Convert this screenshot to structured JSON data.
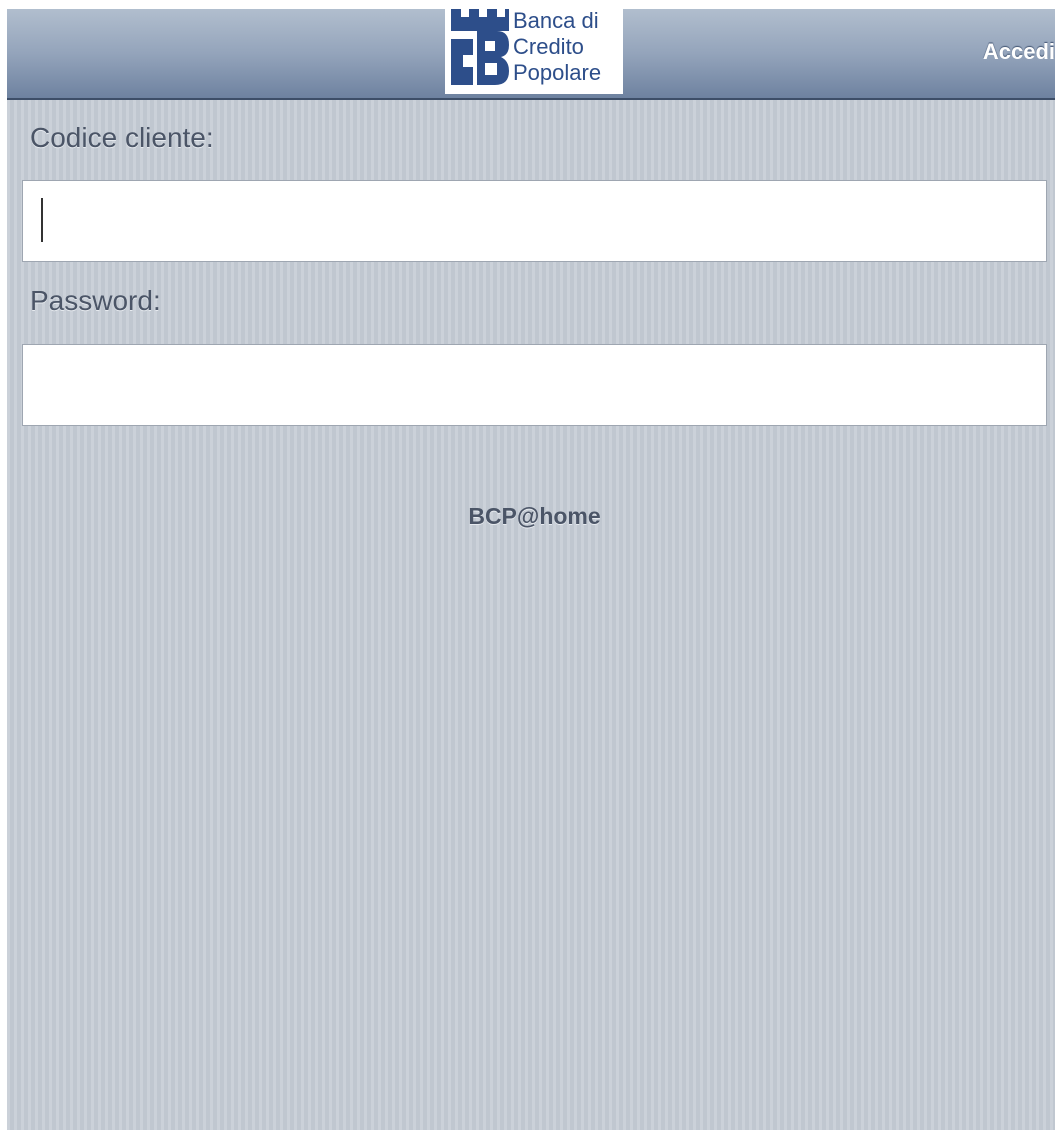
{
  "header": {
    "logo": {
      "name": "bcp-logo",
      "lines": [
        "Banca di",
        "Credito",
        "Popolare"
      ]
    },
    "login_button_label": "Accedi"
  },
  "form": {
    "customer_code": {
      "label": "Codice cliente:",
      "value": "",
      "placeholder": ""
    },
    "password": {
      "label": "Password:",
      "value": "",
      "placeholder": ""
    }
  },
  "footer": {
    "brand": "BCP@home"
  },
  "colors": {
    "navbar_top": "#b1bece",
    "navbar_bottom": "#6e82a0",
    "background": "#c5ccd5",
    "label_text": "#4b5567",
    "logo_blue": "#2d4e8a"
  }
}
